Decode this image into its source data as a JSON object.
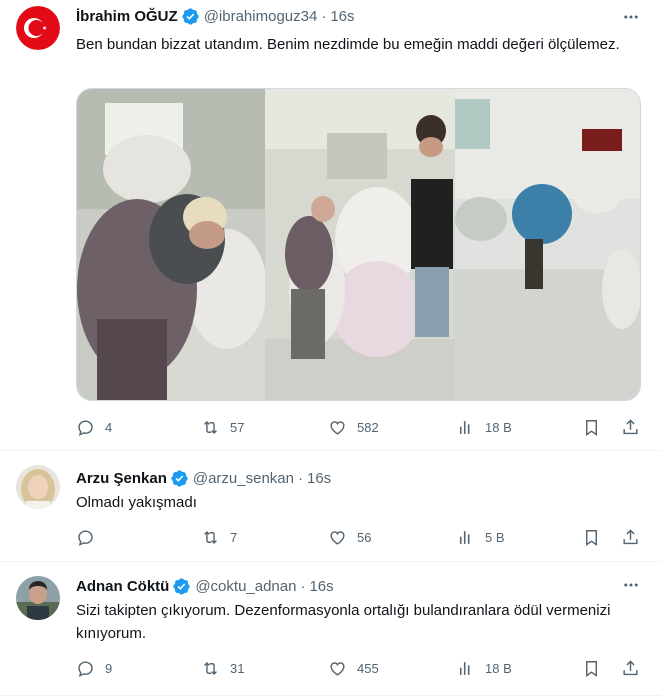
{
  "tweets": [
    {
      "name": "İbrahim OĞUZ",
      "handle": "@ibrahimoguz34",
      "separator": "·",
      "time": "16s",
      "text": "Ben bundan bizzat utandım. Benim nezdimde bu emeğin maddi değeri ölçülemez.",
      "replies": "4",
      "retweets": "57",
      "likes": "582",
      "views": "18 B",
      "avatar": "turkish-flag-avatar",
      "has_media": true
    },
    {
      "name": "Arzu Şenkan",
      "handle": "@arzu_senkan",
      "separator": "·",
      "time": "16s",
      "text": "Olmadı yakışmadı",
      "replies": "",
      "retweets": "7",
      "likes": "56",
      "views": "5 B",
      "avatar": "woman-portrait-avatar"
    },
    {
      "name": "Adnan Cöktü",
      "handle": "@coktu_adnan",
      "separator": "·",
      "time": "16s",
      "text": "Sizi takipten çıkıyorum. Dezenformasyonla ortalığı bulandıranlara ödül vermenizi kınıyorum.",
      "replies": "9",
      "retweets": "31",
      "likes": "455",
      "views": "18 B",
      "avatar": "man-portrait-avatar"
    }
  ],
  "colors": {
    "text": "#0f1419",
    "secondary": "#536471",
    "verified": "#1d9bf0",
    "divider": "#eff3f4"
  },
  "icons": [
    "reply-icon",
    "retweet-icon",
    "like-icon",
    "views-icon",
    "bookmark-icon",
    "share-icon",
    "more-icon",
    "verified-badge-icon"
  ]
}
